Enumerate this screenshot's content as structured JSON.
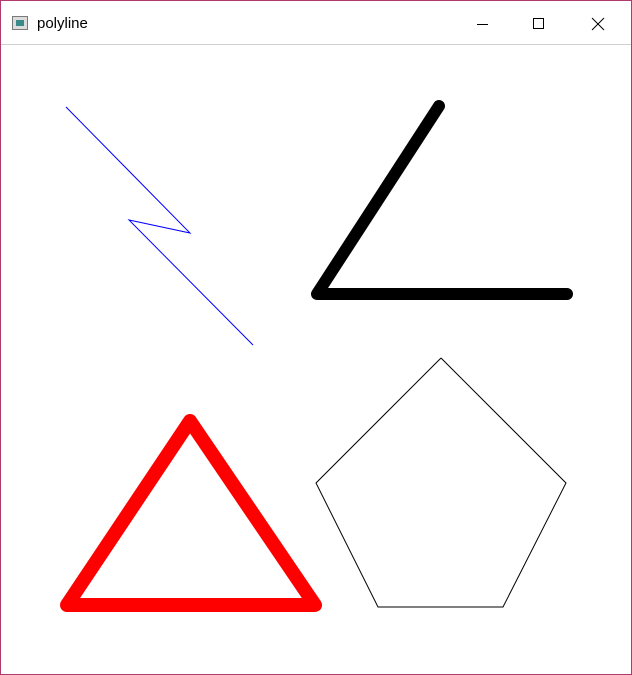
{
  "window": {
    "title": "polyline",
    "icon": "app-window-icon",
    "controls": {
      "minimize_icon": "minimize-icon",
      "maximize_icon": "maximize-icon",
      "close_icon": "close-icon"
    }
  },
  "canvas": {
    "background": "#ffffff",
    "shapes": [
      {
        "name": "zigzag-polyline",
        "color": "#0000ff"
      },
      {
        "name": "angle-polyline",
        "color": "#000000"
      },
      {
        "name": "triangle-polyline",
        "color": "#ff0000"
      },
      {
        "name": "pentagon-polyline",
        "color": "#000000"
      }
    ]
  },
  "colors": {
    "window_border": "#b03a6e",
    "titlebar": "#ffffff"
  }
}
